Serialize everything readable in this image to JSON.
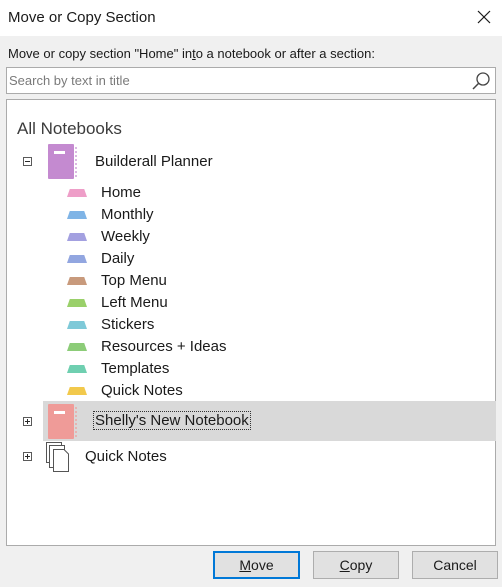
{
  "dialog": {
    "title": "Move or Copy Section",
    "instruction_before": "Move or copy section \"Home\" in",
    "instruction_u": "t",
    "instruction_after": "o a notebook or after a section:"
  },
  "search": {
    "placeholder": "Search by text in title",
    "value": ""
  },
  "tree": {
    "root_label": "All Notebooks",
    "notebooks": [
      {
        "name": "Builderall Planner",
        "color": "#c48ad0",
        "expanded": true,
        "sections": [
          {
            "label": "Home",
            "color": "#ee9ec8"
          },
          {
            "label": "Monthly",
            "color": "#7fb4e6"
          },
          {
            "label": "Weekly",
            "color": "#a3a0e0"
          },
          {
            "label": "Daily",
            "color": "#92a6e0"
          },
          {
            "label": "Top Menu",
            "color": "#c89a7c"
          },
          {
            "label": "Left Menu",
            "color": "#9ad06a"
          },
          {
            "label": "Stickers",
            "color": "#7ec9d8"
          },
          {
            "label": "Resources + Ideas",
            "color": "#8ccc78"
          },
          {
            "label": "Templates",
            "color": "#6fcfb0"
          },
          {
            "label": "Quick Notes",
            "color": "#f2c94c"
          }
        ]
      },
      {
        "name": "Shelly's New Notebook",
        "color": "#ef9b98",
        "expanded": false,
        "selected": true
      },
      {
        "name": "Quick Notes",
        "icon": "pages-icon",
        "expanded": false
      }
    ]
  },
  "buttons": {
    "move_u": "M",
    "move_rest": "ove",
    "copy_u": "C",
    "copy_rest": "opy",
    "cancel": "Cancel"
  }
}
